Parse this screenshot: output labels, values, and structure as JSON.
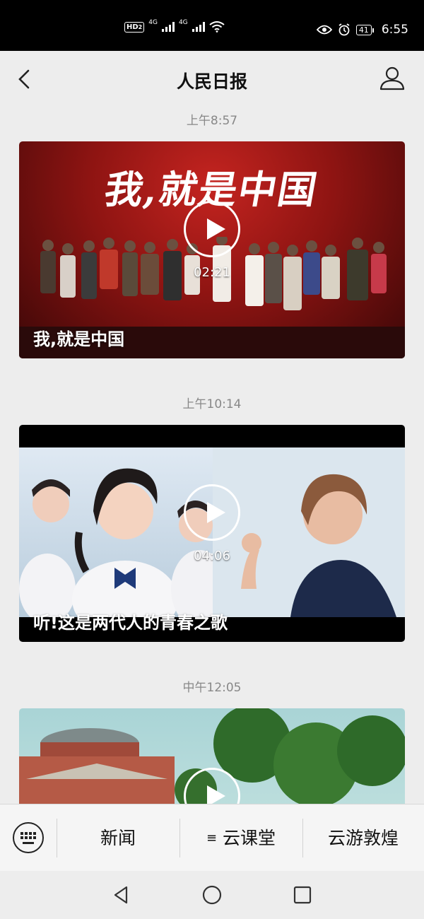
{
  "status_bar": {
    "hd": "HD",
    "sim": "2",
    "net1": "4G",
    "net2": "4G",
    "battery": "41",
    "time": "6:55"
  },
  "header": {
    "title": "人民日报"
  },
  "feed": [
    {
      "time": "上午8:57",
      "banner": "我,就是中国",
      "duration": "02:21",
      "caption": "我,就是中国"
    },
    {
      "time": "上午10:14",
      "duration": "04:06",
      "caption": "听!这是两代人的青春之歌"
    },
    {
      "time": "中午12:05"
    }
  ],
  "menu": {
    "items": [
      "新闻",
      "云课堂",
      "云游敦煌"
    ],
    "menu_icon": "≡"
  },
  "icons": {
    "back": "chevron-left-icon",
    "profile": "person-icon",
    "keyboard": "keyboard-icon",
    "play": "play-icon",
    "nav_back": "triangle-back-icon",
    "nav_home": "circle-home-icon",
    "nav_recent": "square-recent-icon"
  }
}
